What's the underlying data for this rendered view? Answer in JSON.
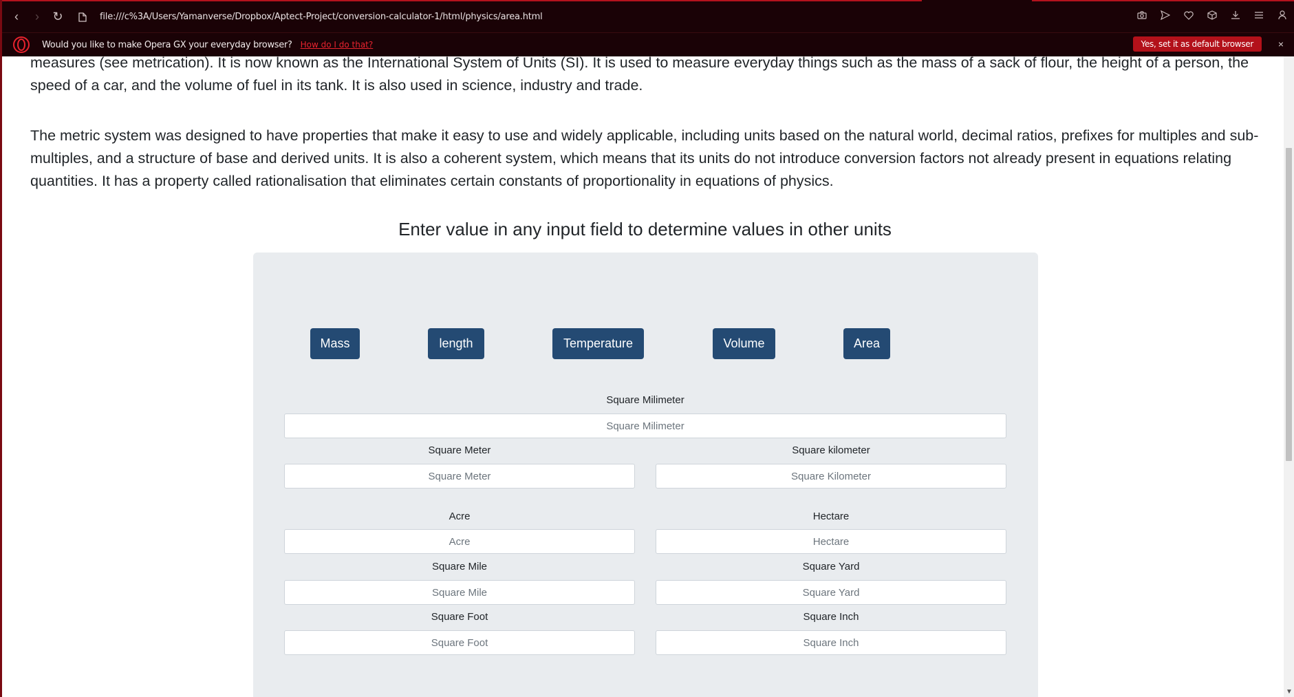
{
  "browser": {
    "url": "file:///c%3A/Users/Yamanverse/Dropbox/Aptect-Project/conversion-calculator-1/html/physics/area.html",
    "infobar_text": "Would you like to make Opera GX your everyday browser?",
    "infobar_link": "How do I do that?",
    "default_button": "Yes, set it as default browser",
    "close_glyph": "×",
    "back_glyph": "‹",
    "forward_glyph": "›",
    "reload_glyph": "↻",
    "accent_color": "#e8232e"
  },
  "article": {
    "paragraph1": "measures (see metrication). It is now known as the International System of Units (SI). It is used to measure everyday things such as the mass of a sack of flour, the height of a person, the speed of a car, and the volume of fuel in its tank. It is also used in science, industry and trade.",
    "paragraph2": "The metric system was designed to have properties that make it easy to use and widely applicable, including units based on the natural world, decimal ratios, prefixes for multiples and sub-multiples, and a structure of base and derived units. It is also a coherent system, which means that its units do not introduce conversion factors not already present in equations relating quantities. It has a property called rationalisation that eliminates certain constants of proportionality in equations of physics."
  },
  "converter": {
    "heading": "Enter value in any input field to determine values in other units",
    "tabs": [
      "Mass",
      "length",
      "Temperature",
      "Volume",
      "Area"
    ],
    "fields": {
      "sq_mm": {
        "label": "Square Milimeter",
        "placeholder": "Square Milimeter"
      },
      "sq_m": {
        "label": "Square Meter",
        "placeholder": "Square Meter"
      },
      "sq_km": {
        "label": "Square kilometer",
        "placeholder": "Square Kilometer"
      },
      "acre": {
        "label": "Acre",
        "placeholder": "Acre"
      },
      "hectare": {
        "label": "Hectare",
        "placeholder": "Hectare"
      },
      "sq_mile": {
        "label": "Square Mile",
        "placeholder": "Square Mile"
      },
      "sq_yard": {
        "label": "Square Yard",
        "placeholder": "Square Yard"
      },
      "sq_foot": {
        "label": "Square Foot",
        "placeholder": "Square Foot"
      },
      "sq_inch": {
        "label": "Square Inch",
        "placeholder": "Square Inch"
      }
    },
    "button_color": "#244a73",
    "panel_color": "#e9ecef"
  }
}
